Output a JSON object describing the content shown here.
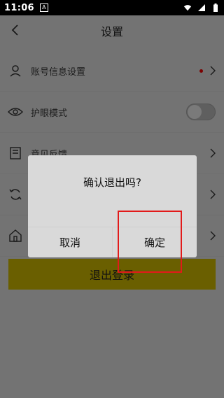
{
  "status_bar": {
    "time": "11:06",
    "a_icon": "A"
  },
  "header": {
    "title": "设置"
  },
  "settings": {
    "items": [
      {
        "label": "账号信息设置",
        "icon": "user-icon",
        "right": "chevron",
        "badge": true
      },
      {
        "label": "护眼模式",
        "icon": "eye-icon",
        "right": "toggle",
        "toggle_on": false
      },
      {
        "label": "意见反馈",
        "icon": "feedback-icon",
        "right": "chevron"
      },
      {
        "label": "",
        "icon": "refresh-icon",
        "right": "chevron"
      },
      {
        "label": "",
        "icon": "home-icon",
        "right": "chevron"
      }
    ]
  },
  "logout": {
    "label": "退出登录"
  },
  "dialog": {
    "message": "确认退出吗?",
    "cancel_label": "取消",
    "confirm_label": "确定"
  },
  "colors": {
    "overlay_bg": "#737373",
    "dialog_bg": "#d9d9d9",
    "logout_bg": "#6a5f00",
    "highlight": "#e21a1a"
  }
}
